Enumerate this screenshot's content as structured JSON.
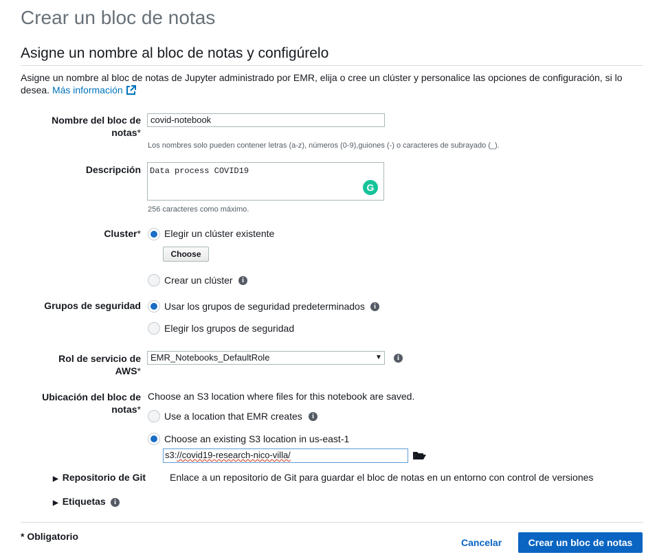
{
  "page": {
    "title": "Crear un bloc de notas",
    "section_title": "Asigne un nombre al bloc de notas y configúrelo",
    "intro": "Asigne un nombre al bloc de notas de Jupyter administrado por EMR, elija o cree un clúster y personalice las opciones de configuración, si lo desea.",
    "more_info": "Más información"
  },
  "name_field": {
    "label_line1": "Nombre del bloc de",
    "label_line2": "notas",
    "required": "*",
    "value": "covid-notebook",
    "hint": "Los nombres solo pueden contener letras (a-z), números (0-9),guiones (-) o caracteres de subrayado (_)."
  },
  "description": {
    "label": "Descripción",
    "value": "Data process COVID19",
    "hint": "256 caracteres como máximo."
  },
  "cluster": {
    "label": "Cluster",
    "required": "*",
    "option_existing": "Elegir un clúster existente",
    "choose_button": "Choose",
    "option_create": "Crear un clúster"
  },
  "security_groups": {
    "label": "Grupos de seguridad",
    "option_default": "Usar los grupos de seguridad predeterminados",
    "option_choose": "Elegir los grupos de seguridad"
  },
  "service_role": {
    "label_line1": "Rol de servicio de",
    "label_line2": "AWS",
    "required": "*",
    "selected": "EMR_Notebooks_DefaultRole"
  },
  "location": {
    "label_line1": "Ubicación del bloc de",
    "label_line2": "notas",
    "required": "*",
    "description": "Choose an S3 location where files for this notebook are saved.",
    "option_emr": "Use a location that EMR creates",
    "option_existing": "Choose an existing S3 location in us-east-1",
    "s3_prefix": "s3:",
    "s3_rest": "//covid19-research-nico-villa/"
  },
  "git": {
    "label": "Repositorio de Git",
    "description": "Enlace a un repositorio de Git para guardar el bloc de notas en un entorno con control de versiones"
  },
  "tags": {
    "label": "Etiquetas"
  },
  "footer": {
    "required_note": "* Obligatorio",
    "cancel": "Cancelar",
    "create": "Crear un bloc de notas"
  },
  "icons": {
    "info": "info-icon",
    "external": "external-link-icon",
    "folder": "folder-open-icon",
    "grammarly": "grammarly-icon",
    "caret": "caret-right-icon"
  },
  "colors": {
    "accent": "#0a64c2",
    "radio": "#1a6dc4",
    "grammarly": "#15c39a"
  }
}
